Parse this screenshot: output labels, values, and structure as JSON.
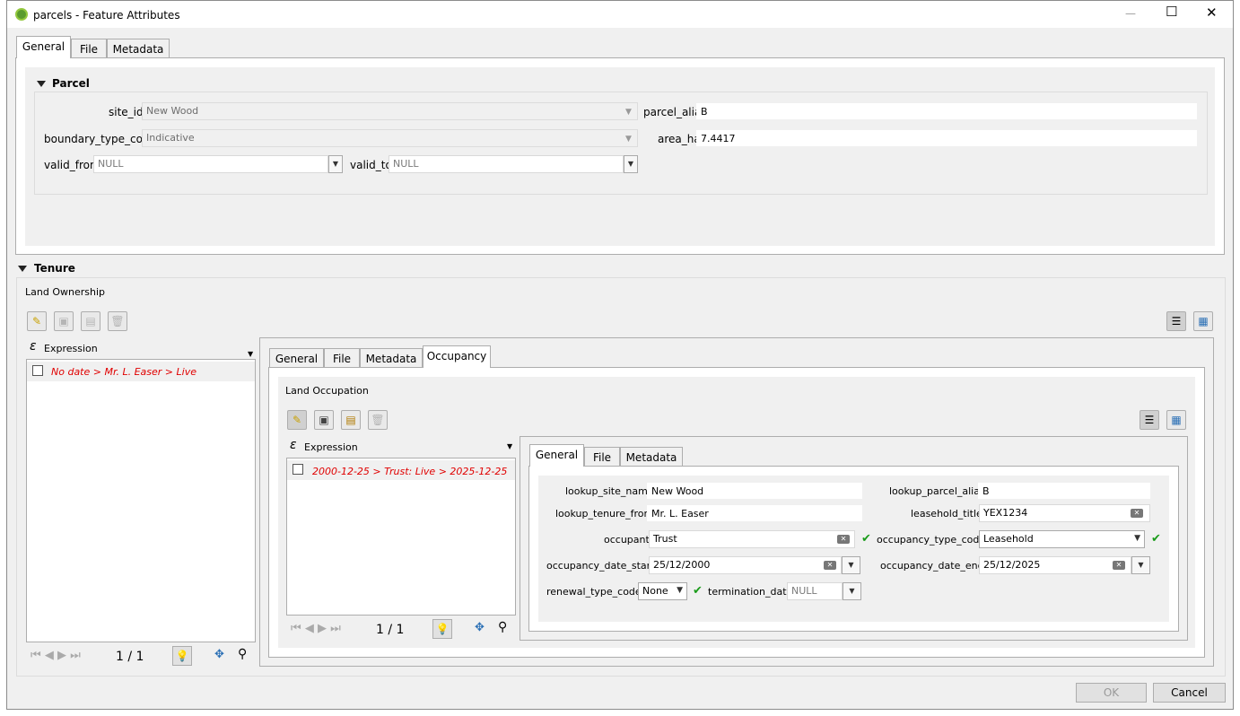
{
  "window": {
    "title": "parcels - Feature Attributes",
    "min_glyph": "—",
    "max_glyph": "☐",
    "close_glyph": "✕"
  },
  "outer_tabs": [
    "General",
    "File",
    "Metadata"
  ],
  "parcel": {
    "heading": "Parcel",
    "site_id_label": "site_id",
    "site_id_value": "New Wood",
    "boundary_label": "boundary_type_code",
    "boundary_value": "Indicative",
    "valid_from_label": "valid_from",
    "valid_from_value": "NULL",
    "valid_to_label": "valid_to",
    "valid_to_value": "NULL",
    "parcel_alias_label": "parcel_alias",
    "parcel_alias_value": "B",
    "area_label": "area_ha",
    "area_value": "7.4417"
  },
  "tenure": {
    "heading": "Tenure",
    "group_label": "Land Ownership",
    "expression_label": "Expression",
    "list_items": [
      "No date > Mr. L. Easer > Live"
    ],
    "nav_count": "1 / 1",
    "inner_tabs": [
      "General",
      "File",
      "Metadata",
      "Occupancy"
    ]
  },
  "occupation": {
    "group_label": "Land Occupation",
    "expression_label": "Expression",
    "list_items": [
      "2000-12-25 > Trust: Live > 2025-12-25"
    ],
    "nav_count": "1 / 1",
    "detail_tabs": [
      "General",
      "File",
      "Metadata"
    ],
    "fields": {
      "lookup_site_name_label": "lookup_site_name",
      "lookup_site_name_value": "New Wood",
      "lookup_tenure_from_label": "lookup_tenure_from",
      "lookup_tenure_from_value": "Mr. L. Easer",
      "occupant_label": "occupant",
      "occupant_value": "Trust",
      "occ_date_start_label": "occupancy_date_start",
      "occ_date_start_value": "25/12/2000",
      "renewal_label": "renewal_type_code",
      "renewal_value": "None",
      "termination_label": "termination_date",
      "termination_value": "NULL",
      "lookup_parcel_alias_label": "lookup_parcel_alias",
      "lookup_parcel_alias_value": "B",
      "leasehold_label": "leasehold_title",
      "leasehold_value": "YEX1234",
      "occ_type_label": "occupancy_type_code",
      "occ_type_value": "Leasehold",
      "occ_date_end_label": "occupancy_date_end",
      "occ_date_end_value": "25/12/2025"
    }
  },
  "footer": {
    "ok_label": "OK",
    "cancel_label": "Cancel"
  },
  "icons": {
    "app": "qgis-logo-icon",
    "edit": "pencil-icon",
    "save": "save-icon",
    "add": "add-feature-icon",
    "delete": "delete-icon",
    "form_view": "form-view-icon",
    "table_view": "table-view-icon",
    "lightbulb": "lightbulb-icon",
    "pan": "pan-to-icon",
    "zoom": "zoom-to-icon"
  },
  "colors": {
    "accent_green": "#1a9c1a",
    "item_red": "#e00000"
  }
}
